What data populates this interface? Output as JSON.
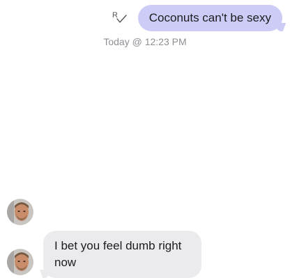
{
  "conversation": {
    "outgoing_message": "Coconuts can't be sexy",
    "read_receipt_icon": "read-receipt-icon",
    "timestamp": "Today @ 12:23 PM",
    "incoming_message": "I bet you feel dumb right now",
    "colors": {
      "outgoing_bubble": "#ccccf7",
      "incoming_bubble": "#ebebed",
      "timestamp_text": "#8e8e93"
    }
  }
}
